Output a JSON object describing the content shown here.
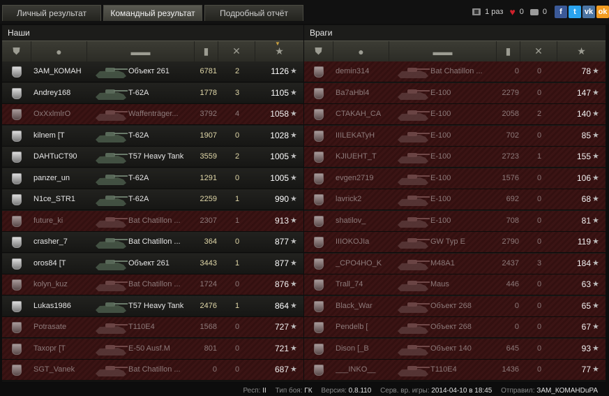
{
  "tabs": [
    {
      "label": "Личный результат",
      "active": false
    },
    {
      "label": "Командный результат",
      "active": true
    },
    {
      "label": "Подробный отчёт",
      "active": false
    }
  ],
  "share": {
    "copies": "1 раз",
    "likes": "0",
    "comments": "0",
    "socials": [
      "facebook-icon",
      "twitter-icon",
      "vk-icon",
      "odnoklassniki-icon"
    ]
  },
  "panels": {
    "left": {
      "title": "Наши",
      "rows": [
        {
          "name": "ЗАМ_КОМАН",
          "vehicle": "Объект 261",
          "damage": "6781",
          "kills": "2",
          "score": "1126",
          "alive": true
        },
        {
          "name": "Andrey168",
          "vehicle": "T-62A",
          "damage": "1778",
          "kills": "3",
          "score": "1105",
          "alive": true
        },
        {
          "name": "OxXxlmlrO",
          "vehicle": "Waffenträger...",
          "damage": "3792",
          "kills": "4",
          "score": "1058",
          "alive": false
        },
        {
          "name": "kilnem [T",
          "vehicle": "T-62A",
          "damage": "1907",
          "kills": "0",
          "score": "1028",
          "alive": true
        },
        {
          "name": "DAHTuCT90",
          "vehicle": "T57 Heavy Tank",
          "damage": "3559",
          "kills": "2",
          "score": "1005",
          "alive": true
        },
        {
          "name": "panzer_un",
          "vehicle": "T-62A",
          "damage": "1291",
          "kills": "0",
          "score": "1005",
          "alive": true
        },
        {
          "name": "N1ce_STR1",
          "vehicle": "T-62A",
          "damage": "2259",
          "kills": "1",
          "score": "990",
          "alive": true
        },
        {
          "name": "future_ki",
          "vehicle": "Bat Chatillon ...",
          "damage": "2307",
          "kills": "1",
          "score": "913",
          "alive": false
        },
        {
          "name": "crasher_7",
          "vehicle": "Bat Chatillon ...",
          "damage": "364",
          "kills": "0",
          "score": "877",
          "alive": true
        },
        {
          "name": "oros84 [T",
          "vehicle": "Объект 261",
          "damage": "3443",
          "kills": "1",
          "score": "877",
          "alive": true
        },
        {
          "name": "kolyn_kuz",
          "vehicle": "Bat Chatillon ...",
          "damage": "1724",
          "kills": "0",
          "score": "876",
          "alive": false
        },
        {
          "name": "Lukas1986",
          "vehicle": "T57 Heavy Tank",
          "damage": "2476",
          "kills": "1",
          "score": "864",
          "alive": true
        },
        {
          "name": "Potrasate",
          "vehicle": "T110E4",
          "damage": "1568",
          "kills": "0",
          "score": "727",
          "alive": false
        },
        {
          "name": "Taxopr [T",
          "vehicle": "E-50 Ausf.M",
          "damage": "801",
          "kills": "0",
          "score": "721",
          "alive": false
        },
        {
          "name": "SGT_Vanek",
          "vehicle": "Bat Chatillon ...",
          "damage": "0",
          "kills": "0",
          "score": "687",
          "alive": false
        }
      ]
    },
    "right": {
      "title": "Враги",
      "rows": [
        {
          "name": "demin314",
          "vehicle": "Bat Chatillon ...",
          "damage": "0",
          "kills": "0",
          "score": "78",
          "alive": false
        },
        {
          "name": "Ba7aHbl4",
          "vehicle": "E-100",
          "damage": "2279",
          "kills": "0",
          "score": "147",
          "alive": false
        },
        {
          "name": "CTAKAH_CA",
          "vehicle": "E-100",
          "damage": "2058",
          "kills": "2",
          "score": "140",
          "alive": false
        },
        {
          "name": "IIILEKATyH",
          "vehicle": "E-100",
          "damage": "702",
          "kills": "0",
          "score": "85",
          "alive": false
        },
        {
          "name": "KJIUEHT_T",
          "vehicle": "E-100",
          "damage": "2723",
          "kills": "1",
          "score": "155",
          "alive": false
        },
        {
          "name": "evgen2719",
          "vehicle": "E-100",
          "damage": "1576",
          "kills": "0",
          "score": "106",
          "alive": false
        },
        {
          "name": "lavrick2",
          "vehicle": "E-100",
          "damage": "692",
          "kills": "0",
          "score": "68",
          "alive": false
        },
        {
          "name": "shatilov_",
          "vehicle": "E-100",
          "damage": "708",
          "kills": "0",
          "score": "81",
          "alive": false
        },
        {
          "name": "IIIOKOJIa",
          "vehicle": "GW Typ E",
          "damage": "2790",
          "kills": "0",
          "score": "119",
          "alive": false
        },
        {
          "name": "_CPO4HO_K",
          "vehicle": "M48A1",
          "damage": "2437",
          "kills": "3",
          "score": "184",
          "alive": false
        },
        {
          "name": "Trall_74",
          "vehicle": "Maus",
          "damage": "446",
          "kills": "0",
          "score": "63",
          "alive": false
        },
        {
          "name": "Black_War",
          "vehicle": "Объект 268",
          "damage": "0",
          "kills": "0",
          "score": "65",
          "alive": false
        },
        {
          "name": "Pendelb [",
          "vehicle": "Объект 268",
          "damage": "0",
          "kills": "0",
          "score": "67",
          "alive": false
        },
        {
          "name": "Dison [_B",
          "vehicle": "Объект 140",
          "damage": "645",
          "kills": "0",
          "score": "93",
          "alive": false
        },
        {
          "name": "___INKO__",
          "vehicle": "T110E4",
          "damage": "1436",
          "kills": "0",
          "score": "77",
          "alive": false
        }
      ]
    }
  },
  "columns": [
    "badge-icon",
    "player-icon",
    "tank-icon",
    "damage-icon",
    "kills-icon",
    "star-icon"
  ],
  "footer": {
    "resp_label": "Респ:",
    "resp_value": "II",
    "type_label": "Тип боя:",
    "type_value": "ГК",
    "version_label": "Версия:",
    "version_value": "0.8.110",
    "time_label": "Серв. вр. игры:",
    "time_value": "2014-04-10 в 18:45",
    "sender_label": "Отправил:",
    "sender_value": "ЗАМ_КОМАНDuPA"
  },
  "colors": {
    "accent_sort": "#c8a040",
    "dead_row": "#3b1414",
    "alive_row": "#1d1d1a",
    "heart": "#d0212b"
  }
}
